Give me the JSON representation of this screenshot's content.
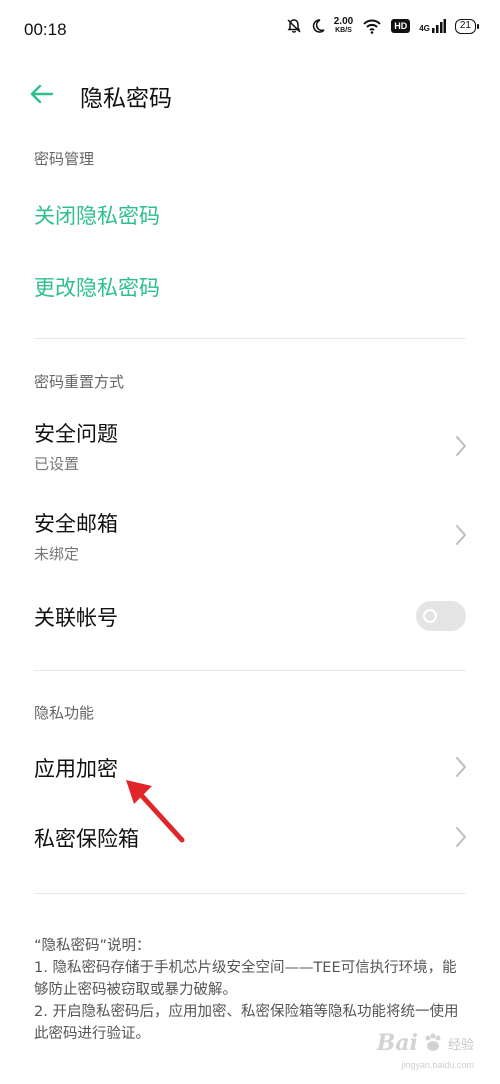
{
  "status_bar": {
    "time": "00:18",
    "speed_value": "2.00",
    "speed_unit": "KB/S",
    "hd_label": "HD",
    "network_label": "4G",
    "battery_level": "21"
  },
  "app_bar": {
    "title": "隐私密码"
  },
  "password_management": {
    "header": "密码管理",
    "items": [
      {
        "label": "关闭隐私密码"
      },
      {
        "label": "更改隐私密码"
      }
    ]
  },
  "reset_methods": {
    "header": "密码重置方式",
    "security_question": {
      "title": "安全问题",
      "subtitle": "已设置"
    },
    "security_email": {
      "title": "安全邮箱",
      "subtitle": "未绑定"
    },
    "linked_account": {
      "title": "关联帐号",
      "enabled": false
    }
  },
  "privacy_features": {
    "header": "隐私功能",
    "app_encryption": {
      "title": "应用加密"
    },
    "private_safe": {
      "title": "私密保险箱"
    }
  },
  "explanation": {
    "heading": "“隐私密码”说明：",
    "line1": "1. 隐私密码存储于手机芯片级安全空间——TEE可信执行环境，能够防止密码被窃取或暴力破解。",
    "line2": "2. 开启隐私密码后，应用加密、私密保险箱等隐私功能将统一使用此密码进行验证。"
  },
  "watermark": {
    "logo": "Bai",
    "logo_suffix": "经验",
    "url": "jingyan.baidu.com"
  },
  "colors": {
    "accent": "#2fbf8b",
    "annotation_arrow": "#e0262b"
  }
}
